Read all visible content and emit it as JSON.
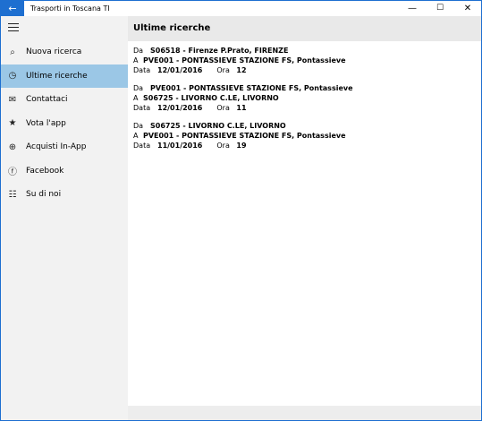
{
  "window": {
    "title": "Trasporti in Toscana TI",
    "back_icon": "←",
    "min_icon": "—",
    "max_icon": "☐",
    "close_icon": "✕",
    "accent": "#1e6fd0"
  },
  "sidebar": {
    "active_color": "#9bc7e6",
    "items": [
      {
        "label": "Nuova ricerca",
        "icon": "⌕"
      },
      {
        "label": "Ultime ricerche",
        "icon": "◷"
      },
      {
        "label": "Contattaci",
        "icon": "✉"
      },
      {
        "label": "Vota l'app",
        "icon": "★"
      },
      {
        "label": "Acquisti In-App",
        "icon": "⊕"
      },
      {
        "label": "Facebook",
        "icon": "ⓕ"
      },
      {
        "label": "Su di noi",
        "icon": "☷"
      }
    ]
  },
  "main": {
    "title": "Ultime ricerche",
    "labels": {
      "from": "Da",
      "to": "A",
      "date": "Data",
      "time": "Ora"
    },
    "results": [
      {
        "from": "S06518 - Firenze P.Prato, FIRENZE",
        "to": "PVE001 - PONTASSIEVE STAZIONE FS, Pontassieve",
        "date": "12/01/2016",
        "time": "12"
      },
      {
        "from": "PVE001 - PONTASSIEVE STAZIONE FS, Pontassieve",
        "to": "S06725 - LIVORNO C.LE, LIVORNO",
        "date": "12/01/2016",
        "time": "11"
      },
      {
        "from": "S06725 - LIVORNO C.LE, LIVORNO",
        "to": "PVE001 - PONTASSIEVE STAZIONE FS, Pontassieve",
        "date": "11/01/2016",
        "time": "19"
      }
    ]
  }
}
